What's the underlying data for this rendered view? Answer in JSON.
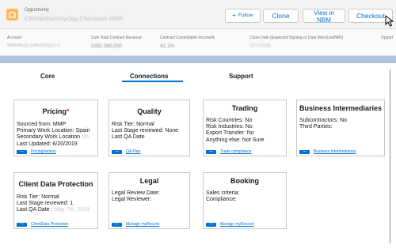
{
  "header": {
    "object_type": "Opportunity",
    "record_name": "CBRNetDummyOpp Checkouts MMP",
    "follow_label": "Follow",
    "clone_label": "Clone",
    "nbm_label_line1": "View in",
    "nbm_label_line2": "NBM",
    "checkout_label": "Checkout"
  },
  "highlights": [
    {
      "label": "Account",
      "value": "MMPROD CHECKOUTS"
    },
    {
      "label": "Sum Total Contract Revenue",
      "value": "USD 280,000"
    },
    {
      "label": "Contract Controllable Income%",
      "value": "41.1%"
    },
    {
      "label": "Close Date (Expected Signing or Date Won/Lost/WD)",
      "value": "11/7/2019"
    },
    {
      "label": "Opport",
      "value": "—"
    }
  ],
  "tabs": {
    "core": "Core",
    "connections": "Connections",
    "support": "Support"
  },
  "cards": {
    "pricing": {
      "title": "Pricing",
      "required": "*",
      "lines": [
        "Sourced from: MMP",
        "Primary Work Location: Spain",
        "Secondary Work Location",
        "Last Updated: 6/20/2019"
      ],
      "secondary_value": "US",
      "link": "PricingVersion"
    },
    "quality": {
      "title": "Quality",
      "lines": [
        "Risk Tier: Normal",
        "Last Stage reviewed: None",
        "Last QA Date"
      ],
      "link": "QA Plan"
    },
    "trading": {
      "title": "Trading",
      "lines": [
        "Risk Countries: No",
        "Risk Industries: No",
        "Export Transfer: No",
        "Anything else: Not Sure"
      ],
      "link": "Trade compliance"
    },
    "business": {
      "title": "Business Intermediaries",
      "lines": [
        "Subcontractors: No",
        "Third Parties:"
      ],
      "link": "Business Intermediaries"
    },
    "cdp": {
      "title": "Client Data Protection",
      "lines": [
        "Risk Tier: Normal",
        "Last Stage reviewed: 1",
        "Last QA Date :"
      ],
      "qa_date_value": "May 7th, 2019",
      "link": "ClientData Protection"
    },
    "legal": {
      "title": "Legal",
      "lines": [
        "Legal Review Date:",
        "Legal Reviewer:"
      ],
      "link": "Manage myRecord"
    },
    "booking": {
      "title": "Booking",
      "lines": [
        "Sales criteria:",
        "Compliance:"
      ],
      "link": "Manage myRecord"
    }
  },
  "colors": {
    "brand_blue": "#0070d2",
    "required_red": "#c23934",
    "opportunity_icon": "#fcb95b",
    "page_background": "#b0c4de"
  }
}
